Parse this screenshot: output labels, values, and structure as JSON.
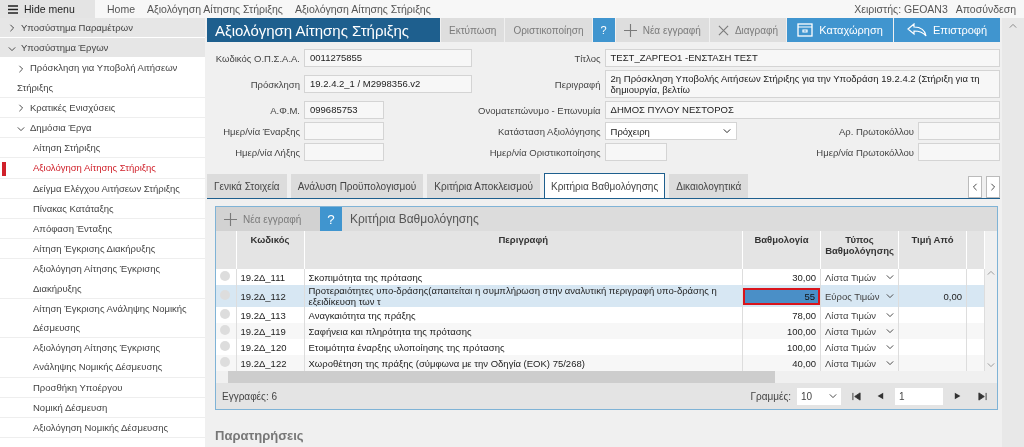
{
  "topbar": {
    "menu_button": "Hide menu",
    "breadcrumbs": [
      "Home",
      "Αξιολόγηση Αίτησης Στήριξης",
      "Αξιολόγηση Αίτησης Στήριξης"
    ],
    "user": "Χειριστής: GEOAN3",
    "logout": "Αποσύνδεση"
  },
  "sidebar": {
    "items": [
      {
        "label": "Υποσύστημα Παραμέτρων",
        "expanded": false
      },
      {
        "label": "Υποσύστημα Έργων",
        "expanded": true,
        "children": [
          {
            "label": "Πρόσκληση για Υποβολή Αιτήσεων Στήριξης",
            "expanded": false
          },
          {
            "label": "Κρατικές Ενισχύσεις",
            "expanded": false
          },
          {
            "label": "Δημόσια Έργα",
            "expanded": true,
            "children": [
              {
                "label": "Αίτηση Στήριξης",
                "selected": false
              },
              {
                "label": "Αξιολόγηση Αίτησης Στήριξης",
                "selected": true
              },
              {
                "label": "Δείγμα Ελέγχου Αιτήσεων Στήριξης",
                "selected": false
              },
              {
                "label": "Πίνακας Κατάταξης",
                "selected": false
              },
              {
                "label": "Απόφαση Ένταξης",
                "selected": false
              },
              {
                "label": "Αίτηση Έγκρισης Διακήρυξης",
                "selected": false
              },
              {
                "label": "Αξιολόγηση Αίτησης Έγκρισης Διακήρυξης",
                "selected": false
              },
              {
                "label": "Αίτηση Έγκρισης Ανάληψης Νομικής Δέσμευσης",
                "selected": false
              },
              {
                "label": "Αξιολόγηση Αίτησης Έγκρισης Ανάληψης Νομικής Δέσμευσης",
                "selected": false
              },
              {
                "label": "Προσθήκη Υποέργου",
                "selected": false
              },
              {
                "label": "Νομική Δέσμευση",
                "selected": false
              },
              {
                "label": "Αξιολόγηση Νομικής Δέσμευσης",
                "selected": false
              }
            ]
          }
        ]
      }
    ]
  },
  "header": {
    "title": "Αξιολόγηση Αίτησης Στήριξης",
    "buttons": [
      {
        "label": "Εκτύπωση",
        "kind": "print",
        "disabled": true
      },
      {
        "label": "Οριστικοποίηση",
        "kind": "finalize",
        "disabled": true
      },
      {
        "label": "?",
        "kind": "help",
        "disabled": false
      },
      {
        "label": "Νέα εγγραφή",
        "kind": "new",
        "disabled": true
      },
      {
        "label": "Διαγραφή",
        "kind": "delete",
        "disabled": true
      },
      {
        "label": "Καταχώρηση",
        "kind": "save",
        "disabled": false
      },
      {
        "label": "Επιστροφή",
        "kind": "back",
        "disabled": false
      }
    ]
  },
  "form": {
    "rows": [
      {
        "left": {
          "label": "Κωδικός Ο.Π.Σ.Α.Α.",
          "value": "0011275855"
        },
        "right": [
          {
            "label": "Τίτλος",
            "value": "ΤΕΣΤ_ΖΑΡΓΕΟ1 -ΕΝΣΤΑΣΗ ΤΕΣΤ",
            "kind": "text"
          }
        ]
      },
      {
        "left": {
          "label": "Πρόσκληση",
          "value": "19.2.4.2_1 / M2998356.v2"
        },
        "right": [
          {
            "label": "Περιγραφή",
            "value": "2η Πρόσκληση Υποβολής Αιτήσεων Στήριξης για την Υποδράση 19.2.4.2 (Στήριξη για τη δημιουργία, βελτίω",
            "kind": "text"
          }
        ]
      },
      {
        "left": {
          "label": "Α.Φ.Μ.",
          "value": "099685753"
        },
        "right": [
          {
            "label": "Ονοματεπώνυμο - Επωνυμία",
            "value": "ΔΗΜΟΣ ΠΥΛΟΥ ΝΕΣΤΟΡΟΣ",
            "kind": "text"
          }
        ]
      },
      {
        "left": {
          "label": "Ημερ/νία Έναρξης"
        },
        "right": [
          {
            "label": "Κατάσταση Αξιολόγησης",
            "value": "Πρόχειρη",
            "kind": "select"
          },
          {
            "label": "Αρ. Πρωτοκόλλου",
            "kind": "text"
          }
        ]
      },
      {
        "left": {
          "label": "Ημερ/νία Λήξης"
        },
        "right": [
          {
            "label": "Ημερ/νία Οριστικοποίησης",
            "kind": "text"
          },
          {
            "label": "Ημερ/νία Πρωτοκόλλου",
            "kind": "text"
          }
        ]
      }
    ]
  },
  "tabs": [
    {
      "label": "Γενικά Στοιχεία",
      "selected": false
    },
    {
      "label": "Ανάλυση Προϋπολογισμού",
      "selected": false
    },
    {
      "label": "Κριτήρια Αποκλεισμού",
      "selected": false
    },
    {
      "label": "Κριτήρια Βαθμολόγησης",
      "selected": true
    },
    {
      "label": "Δικαιολογητικά",
      "selected": false
    }
  ],
  "grid": {
    "new_button": {
      "label": "Νέα εγγραφή",
      "disabled": true
    },
    "help_button": "?",
    "title": "Κριτήρια Βαθμολόγησης",
    "columns": [
      "Κωδικός",
      "Περιγραφή",
      "Βαθμολογία",
      "Τύπος Βαθμολόγησης",
      "Τιμή Από"
    ],
    "rows": [
      {
        "code": "19.2Δ_111",
        "description": "Σκοπιμότητα της πρότασης",
        "score": "30,00",
        "type": "Λίστα Τιμών",
        "selected": false
      },
      {
        "code": "19.2Δ_112",
        "description": "Προτεραιότητες υπο-δράσης(απαιτείται η συμπλήρωση στην αναλυτική περιγραφή υπο-δράσης η εξειδίκευση των τ",
        "score": "55",
        "type": "Εύρος Τιμών",
        "value_from": "0,00",
        "selected": true
      },
      {
        "code": "19.2Δ_113",
        "description": "Αναγκαιότητα της πράξης",
        "score": "78,00",
        "type": "Λίστα Τιμών",
        "selected": false
      },
      {
        "code": "19.2Δ_119",
        "description": "Σαφήνεια και πληρότητα της πρότασης",
        "score": "100,00",
        "type": "Λίστα Τιμών",
        "selected": false
      },
      {
        "code": "19.2Δ_120",
        "description": "Ετοιμότητα έναρξης υλοποίησης της πρότασης",
        "score": "100,00",
        "type": "Λίστα Τιμών",
        "selected": false
      },
      {
        "code": "19.2Δ_122",
        "description": "Χωροθέτηση της πράξης (σύμφωνα με την Οδηγία (ΕΟΚ) 75/268)",
        "score": "40,00",
        "type": "Λίστα Τιμών",
        "selected": false
      }
    ],
    "records": "Εγγραφές: 6",
    "rows_label": "Γραμμές:",
    "page_size": "10",
    "page": "1"
  },
  "remarks_title": "Παρατηρήσεις"
}
